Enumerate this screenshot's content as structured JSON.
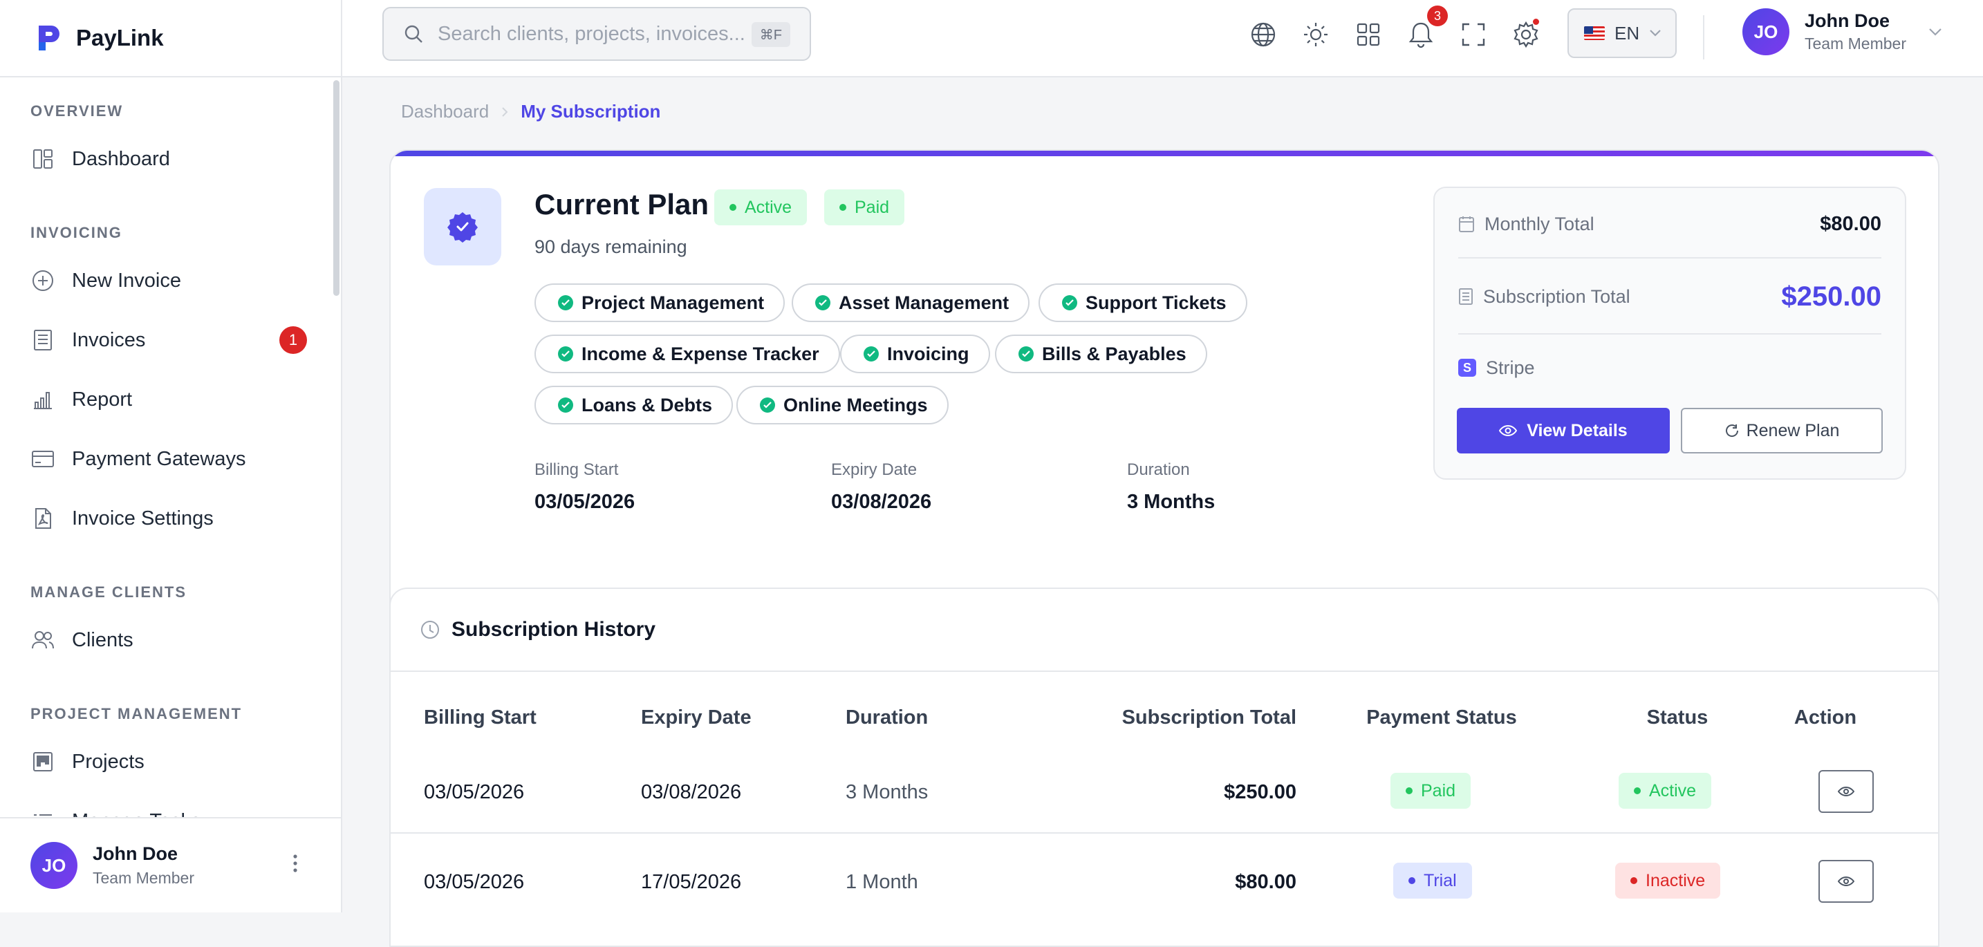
{
  "brand": {
    "name": "PayLink",
    "accent": "#4f46e5"
  },
  "sidebar": {
    "sections": [
      {
        "title": "OVERVIEW"
      },
      {
        "title": "INVOICING"
      },
      {
        "title": "MANAGE CLIENTS"
      },
      {
        "title": "PROJECT MANAGEMENT"
      }
    ],
    "items": [
      {
        "label": "Dashboard",
        "icon": "dashboard-icon"
      },
      {
        "label": "New Invoice",
        "icon": "plus-circle-icon"
      },
      {
        "label": "Invoices",
        "icon": "invoice-icon",
        "badge": "1"
      },
      {
        "label": "Report",
        "icon": "bar-chart-icon"
      },
      {
        "label": "Payment Gateways",
        "icon": "credit-card-icon"
      },
      {
        "label": "Invoice Settings",
        "icon": "pdf-file-icon"
      },
      {
        "label": "Clients",
        "icon": "users-icon"
      },
      {
        "label": "Projects",
        "icon": "kanban-icon"
      },
      {
        "label": "Manage Tasks",
        "icon": "tasks-icon"
      }
    ],
    "user": {
      "initials": "JO",
      "name": "John Doe",
      "role": "Team Member"
    }
  },
  "topbar": {
    "search_placeholder": "Search clients, projects, invoices...",
    "search_shortcut": "⌘F",
    "notification_count": "3",
    "language": "EN",
    "user": {
      "initials": "JO",
      "name": "John Doe",
      "role": "Team Member"
    }
  },
  "breadcrumb": {
    "parent": "Dashboard",
    "current": "My Subscription"
  },
  "current_plan": {
    "title": "Current Plan",
    "status": "Active",
    "payment": "Paid",
    "remaining": "90 days remaining",
    "features": [
      "Project Management",
      "Asset Management",
      "Support Tickets",
      "Income & Expense Tracker",
      "Invoicing",
      "Bills & Payables",
      "Loans & Debts",
      "Online Meetings"
    ],
    "billing_start_label": "Billing Start",
    "billing_start": "03/05/2026",
    "expiry_label": "Expiry Date",
    "expiry": "03/08/2026",
    "duration_label": "Duration",
    "duration": "3 Months",
    "summary": {
      "monthly_label": "Monthly Total",
      "monthly_value": "$80.00",
      "subscription_label": "Subscription Total",
      "subscription_value": "$250.00",
      "gateway": "Stripe",
      "view_details": "View Details",
      "renew_plan": "Renew Plan"
    }
  },
  "history": {
    "title": "Subscription History",
    "columns": [
      "Billing Start",
      "Expiry Date",
      "Duration",
      "Subscription Total",
      "Payment Status",
      "Status",
      "Action"
    ],
    "rows": [
      {
        "billing_start": "03/05/2026",
        "expiry": "03/08/2026",
        "duration": "3 Months",
        "total": "$250.00",
        "payment": "Paid",
        "status": "Active"
      },
      {
        "billing_start": "03/05/2026",
        "expiry": "17/05/2026",
        "duration": "1 Month",
        "total": "$80.00",
        "payment": "Trial",
        "status": "Inactive"
      }
    ]
  }
}
